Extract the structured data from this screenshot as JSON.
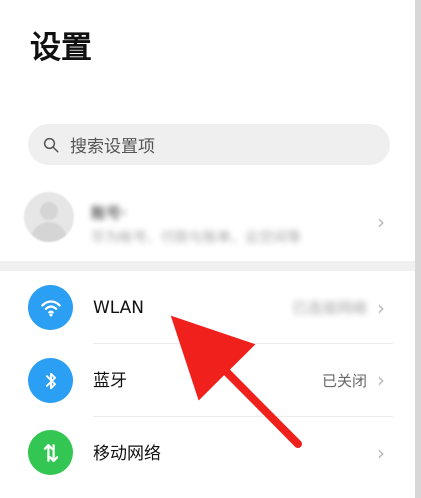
{
  "page": {
    "title": "设置"
  },
  "search": {
    "placeholder": "搜索设置项"
  },
  "profile": {
    "name": "账号·",
    "subtitle": "华为帐号、付款与账单、云空间等"
  },
  "settings": {
    "items": [
      {
        "label": "WLAN",
        "value": "已连接网络",
        "icon": "wifi-icon",
        "icon_color": "#2b9ff3"
      },
      {
        "label": "蓝牙",
        "value": "已关闭",
        "icon": "bluetooth-icon",
        "icon_color": "#2b9ff3"
      },
      {
        "label": "移动网络",
        "value": "",
        "icon": "mobile-network-icon",
        "icon_color": "#33c653"
      }
    ]
  },
  "annotation": {
    "arrow_color": "#f0201c"
  }
}
